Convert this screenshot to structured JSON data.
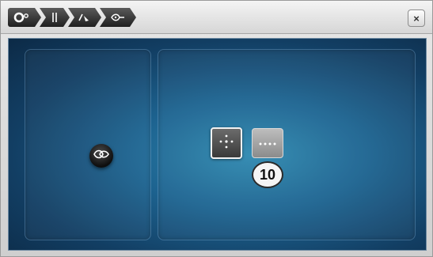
{
  "breadcrumb": {
    "items": [
      {
        "icon": "presser-foot-pressure-icon"
      },
      {
        "icon": "needle-icon"
      },
      {
        "icon": "thread-tension-icon"
      },
      {
        "icon": "stitch-pattern-icon"
      }
    ]
  },
  "close_label": "×",
  "left_panel": {
    "button_icon": "pattern-repeat-icon"
  },
  "right_panel": {
    "options": [
      {
        "icon": "center-dots-icon",
        "selected": true
      },
      {
        "icon": "dotted-line-icon",
        "selected": false
      }
    ],
    "counter_value": "10"
  },
  "colors": {
    "background_center": "#2f8ab1",
    "background_edge": "#0c2a46",
    "crumb_dark": "#1f1f1f"
  }
}
